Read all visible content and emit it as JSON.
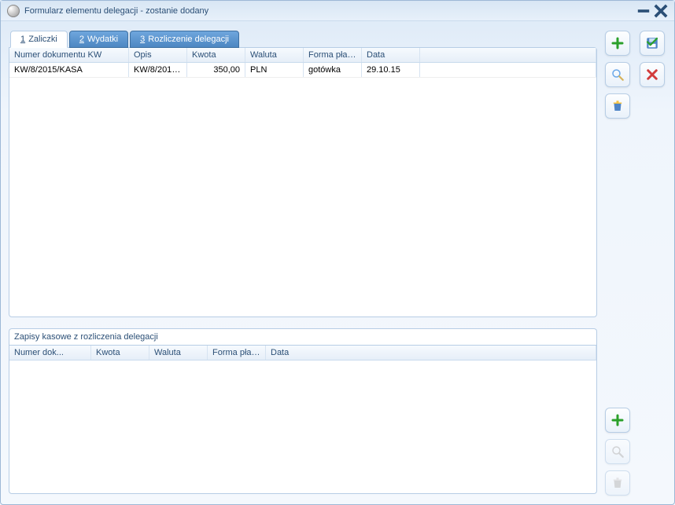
{
  "window": {
    "title": "Formularz elementu delegacji - zostanie dodany"
  },
  "tabs": [
    {
      "prefix": "1",
      "label": "Zaliczki"
    },
    {
      "prefix": "2",
      "label": "Wydatki"
    },
    {
      "prefix": "3",
      "label": "Rozliczenie delegacji"
    }
  ],
  "grid1": {
    "columns": [
      "Numer dokumentu KW",
      "Opis",
      "Kwota",
      "Waluta",
      "Forma płat...",
      "Data"
    ],
    "rows": [
      {
        "doc": "KW/8/2015/KASA",
        "opis": "KW/8/2015...",
        "kwota": "350,00",
        "waluta": "PLN",
        "forma": "gotówka",
        "data": "29.10.15"
      }
    ]
  },
  "grid2": {
    "title": "Zapisy kasowe z rozliczenia delegacji",
    "columns": [
      "Numer dok...",
      "Kwota",
      "Waluta",
      "Forma płat...",
      "Data"
    ]
  },
  "colors": {
    "accent": "#4d87c2"
  }
}
